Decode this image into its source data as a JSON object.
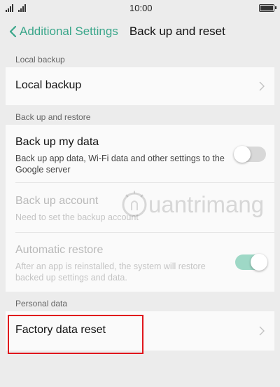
{
  "status_bar": {
    "time": "10:00"
  },
  "nav": {
    "back_label": "Additional Settings",
    "title": "Back up and reset"
  },
  "sections": {
    "local_backup_header": "Local backup",
    "backup_restore_header": "Back up and restore",
    "personal_data_header": "Personal data"
  },
  "rows": {
    "local_backup": {
      "title": "Local backup"
    },
    "back_up_my_data": {
      "title": "Back up my data",
      "subtitle": "Back up app data, Wi-Fi data and other settings to the Google server",
      "toggle_on": false
    },
    "back_up_account": {
      "title": "Back up account",
      "subtitle": "Need to set the backup account"
    },
    "automatic_restore": {
      "title": "Automatic restore",
      "subtitle": "After an app is reinstalled, the system will restore backed up settings and data.",
      "toggle_on": true
    },
    "factory_data_reset": {
      "title": "Factory data reset"
    }
  },
  "watermark": {
    "text": "uantrimang"
  },
  "colors": {
    "accent": "#3aa68a",
    "highlight": "#e0161c",
    "toggle_on": "#9ed8c6"
  }
}
